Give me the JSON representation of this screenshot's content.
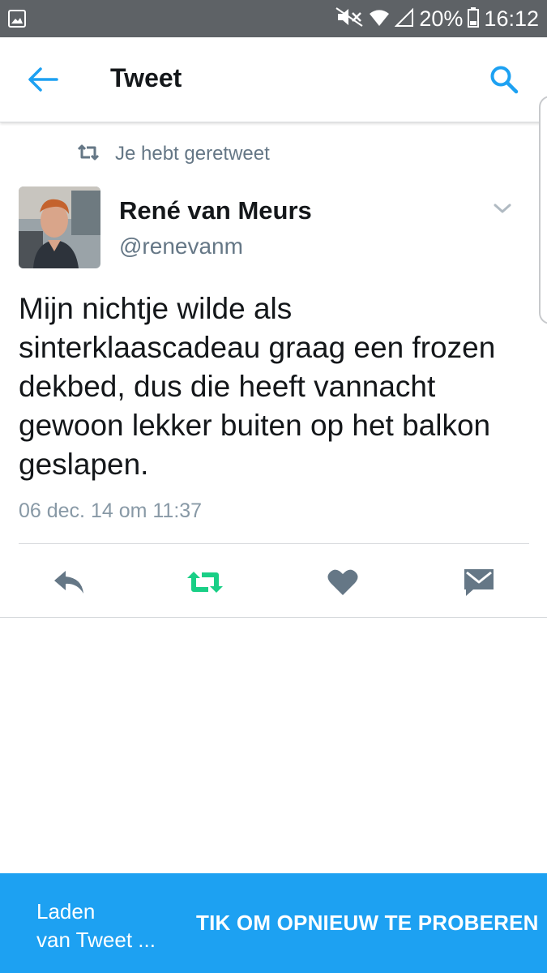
{
  "status_bar": {
    "battery": "20%",
    "time": "16:12"
  },
  "header": {
    "title": "Tweet"
  },
  "tweet": {
    "retweet_notice": "Je hebt geretweet",
    "author_name": "René van Meurs",
    "author_handle": "@renevanm",
    "lines": [
      "Mijn nichtje wilde als",
      "sinterklaascadeau graag een frozen",
      "dekbed, dus die heeft vannacht",
      "gewoon lekker buiten op het balkon",
      "geslapen."
    ],
    "timestamp": "06 dec. 14 om 11:37"
  },
  "actions": {
    "retweeted": true,
    "retweet_color": "#19cf86",
    "icon_color": "#657786"
  },
  "bottom_bar": {
    "loading_line1": "Laden",
    "loading_line2": "van Tweet ...",
    "retry_label": "TIK OM OPNIEUW TE PROBEREN"
  },
  "colors": {
    "accent": "#1da1f2",
    "status_bar": "#5e6266"
  }
}
